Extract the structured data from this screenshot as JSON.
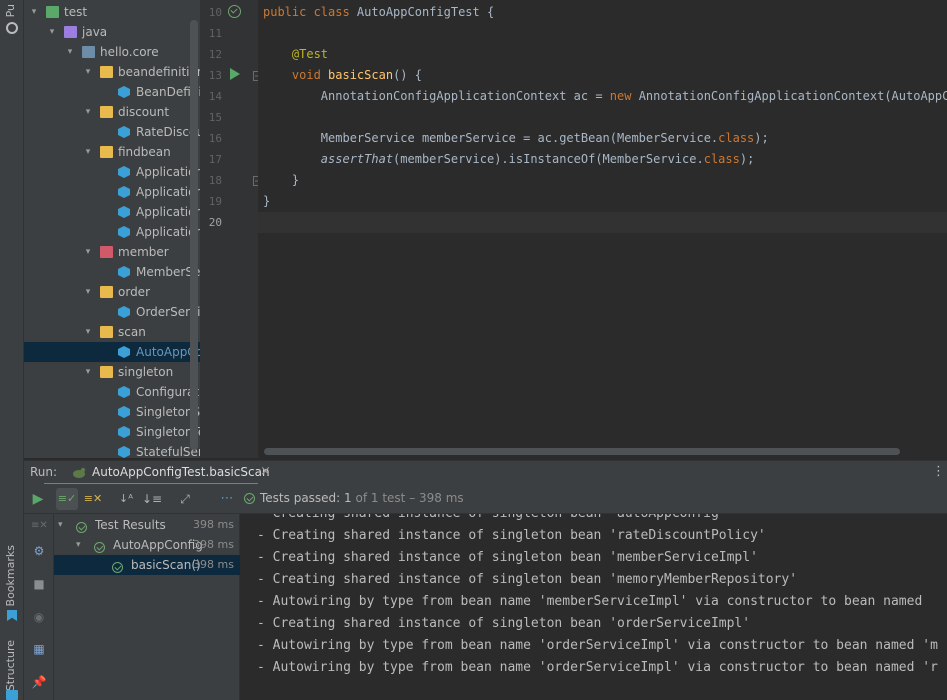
{
  "left_strip": {
    "top_label": "Pu",
    "bookmarks_label": "Bookmarks",
    "structure_label": "Structure"
  },
  "tree": {
    "items": [
      {
        "label": "test",
        "kind": "folder-test",
        "depth": 0,
        "arrow": "▾"
      },
      {
        "label": "java",
        "kind": "folder-src",
        "depth": 1,
        "arrow": "▾"
      },
      {
        "label": "hello.core",
        "kind": "folder-pkg",
        "depth": 2,
        "arrow": "▾"
      },
      {
        "label": "beandefinition",
        "kind": "folder",
        "depth": 3,
        "arrow": "▾"
      },
      {
        "label": "BeanDefinitionT",
        "kind": "class",
        "depth": 4,
        "arrow": ""
      },
      {
        "label": "discount",
        "kind": "folder",
        "depth": 3,
        "arrow": "▾"
      },
      {
        "label": "RateDiscountPo",
        "kind": "class",
        "depth": 4,
        "arrow": ""
      },
      {
        "label": "findbean",
        "kind": "folder",
        "depth": 3,
        "arrow": "▾"
      },
      {
        "label": "ApplicationCon",
        "kind": "class",
        "depth": 4,
        "arrow": ""
      },
      {
        "label": "ApplicationCon",
        "kind": "class",
        "depth": 4,
        "arrow": ""
      },
      {
        "label": "ApplicationCon",
        "kind": "class",
        "depth": 4,
        "arrow": ""
      },
      {
        "label": "ApplicationCon",
        "kind": "class",
        "depth": 4,
        "arrow": ""
      },
      {
        "label": "member",
        "kind": "folder-member",
        "depth": 3,
        "arrow": "▾"
      },
      {
        "label": "MemberService",
        "kind": "class",
        "depth": 4,
        "arrow": ""
      },
      {
        "label": "order",
        "kind": "folder",
        "depth": 3,
        "arrow": "▾"
      },
      {
        "label": "OrderServiceTes",
        "kind": "class",
        "depth": 4,
        "arrow": ""
      },
      {
        "label": "scan",
        "kind": "folder",
        "depth": 3,
        "arrow": "▾"
      },
      {
        "label": "AutoAppConfig",
        "kind": "class",
        "depth": 4,
        "arrow": "",
        "selected": true
      },
      {
        "label": "singleton",
        "kind": "folder",
        "depth": 3,
        "arrow": "▾"
      },
      {
        "label": "ConfigurationS",
        "kind": "class",
        "depth": 4,
        "arrow": ""
      },
      {
        "label": "SingletonServic",
        "kind": "class",
        "depth": 4,
        "arrow": ""
      },
      {
        "label": "SingletonTest",
        "kind": "class",
        "depth": 4,
        "arrow": ""
      },
      {
        "label": "StatefulService",
        "kind": "class",
        "depth": 4,
        "arrow": ""
      }
    ]
  },
  "editor": {
    "current_line": "20",
    "lines": [
      {
        "num": "10",
        "tokens": [
          {
            "t": "public class ",
            "c": "kw"
          },
          {
            "t": "AutoAppConfigTest {",
            "c": ""
          }
        ]
      },
      {
        "num": "11",
        "tokens": []
      },
      {
        "num": "12",
        "tokens": [
          {
            "t": "    ",
            "c": ""
          },
          {
            "t": "@Test",
            "c": "ann"
          }
        ]
      },
      {
        "num": "13",
        "tokens": [
          {
            "t": "    ",
            "c": ""
          },
          {
            "t": "void ",
            "c": "kw"
          },
          {
            "t": "basicScan",
            "c": "fn"
          },
          {
            "t": "() {",
            "c": ""
          }
        ]
      },
      {
        "num": "14",
        "tokens": [
          {
            "t": "        AnnotationConfigApplicationContext ac = ",
            "c": ""
          },
          {
            "t": "new ",
            "c": "kw"
          },
          {
            "t": "AnnotationConfigApplicationContext(AutoAppConf",
            "c": ""
          }
        ]
      },
      {
        "num": "15",
        "tokens": []
      },
      {
        "num": "16",
        "tokens": [
          {
            "t": "        MemberService memberService = ac.getBean(MemberService.",
            "c": ""
          },
          {
            "t": "class",
            "c": "kw"
          },
          {
            "t": ");",
            "c": ""
          }
        ]
      },
      {
        "num": "17",
        "tokens": [
          {
            "t": "        ",
            "c": ""
          },
          {
            "t": "assertThat",
            "c": "it"
          },
          {
            "t": "(memberService).isInstanceOf(MemberService.",
            "c": ""
          },
          {
            "t": "class",
            "c": "kw"
          },
          {
            "t": ");",
            "c": ""
          }
        ]
      },
      {
        "num": "18",
        "tokens": [
          {
            "t": "    }",
            "c": ""
          }
        ]
      },
      {
        "num": "19",
        "tokens": [
          {
            "t": "}",
            "c": ""
          }
        ]
      },
      {
        "num": "20",
        "tokens": []
      }
    ]
  },
  "run": {
    "label": "Run:",
    "tab_title": "AutoAppConfigTest.basicScan",
    "tab_close": "×",
    "status_prefix": "Tests passed:",
    "status_count": "1",
    "status_of": "of 1 test – 398 ms",
    "more": "⋯"
  },
  "results": {
    "rows": [
      {
        "label": "Test Results",
        "duration": "398 ms",
        "indent": 0,
        "arrow": "▾"
      },
      {
        "label": "AutoAppConfig",
        "duration": "398 ms",
        "indent": 1,
        "arrow": "▾"
      },
      {
        "label": "basicScan()",
        "duration": "398 ms",
        "indent": 2,
        "arrow": "",
        "selected": true
      }
    ]
  },
  "console": {
    "lines": [
      "- Creating shared instance of singleton bean 'autoAppConfig'",
      "- Creating shared instance of singleton bean 'rateDiscountPolicy'",
      "- Creating shared instance of singleton bean 'memberServiceImpl'",
      "- Creating shared instance of singleton bean 'memoryMemberRepository'",
      "- Autowiring by type from bean name 'memberServiceImpl' via constructor to bean named",
      "- Creating shared instance of singleton bean 'orderServiceImpl'",
      "- Autowiring by type from bean name 'orderServiceImpl' via constructor to bean named 'm",
      "- Autowiring by type from bean name 'orderServiceImpl' via constructor to bean named 'r"
    ]
  },
  "colors": {
    "pass_green": "#6fa770",
    "keyword": "#cc7832",
    "annotation": "#bbb529",
    "method": "#ffc66d",
    "selection": "#0d293e"
  }
}
